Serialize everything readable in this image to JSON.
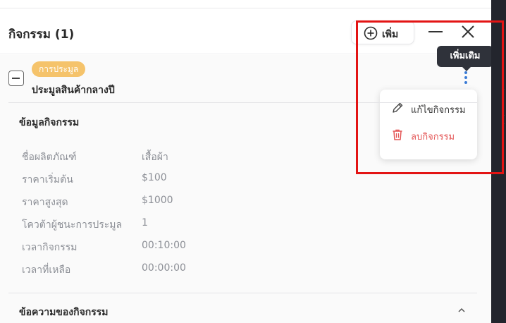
{
  "header": {
    "title": "กิจกรรม  (1)",
    "add_label": "เพิ่ม"
  },
  "activity": {
    "tag": "การประมูล",
    "name": "ประมูลสินค้ากลางปี",
    "more_tooltip": "เพิ่มเติม"
  },
  "menu": {
    "edit_label": "แก้ไขกิจกรรม",
    "delete_label": "ลบกิจกรรม"
  },
  "info": {
    "title": "ข้อมูลกิจกรรม",
    "rows": [
      {
        "label": "ชื่อผลิตภัณฑ์",
        "value": "เสื้อผ้า"
      },
      {
        "label": "ราคาเริ่มต้น",
        "value": "$100"
      },
      {
        "label": "ราคาสูงสุด",
        "value": "$1000"
      },
      {
        "label": "โควต้าผู้ชนะการประมูล",
        "value": "1"
      },
      {
        "label": "เวลากิจกรรม",
        "value": "00:10:00"
      },
      {
        "label": "เวลาที่เหลือ",
        "value": "00:00:00"
      }
    ]
  },
  "messages": {
    "title": "ข้อความของกิจกรรม"
  },
  "colors": {
    "tag_bg": "#f5c36b",
    "accent": "#3a7bd5",
    "danger": "#e45757",
    "highlight": "#e31414"
  },
  "icons": [
    "plus-circle-icon",
    "minimize-icon",
    "close-icon",
    "more-vertical-icon",
    "pencil-icon",
    "trash-icon",
    "chevron-up-icon"
  ]
}
